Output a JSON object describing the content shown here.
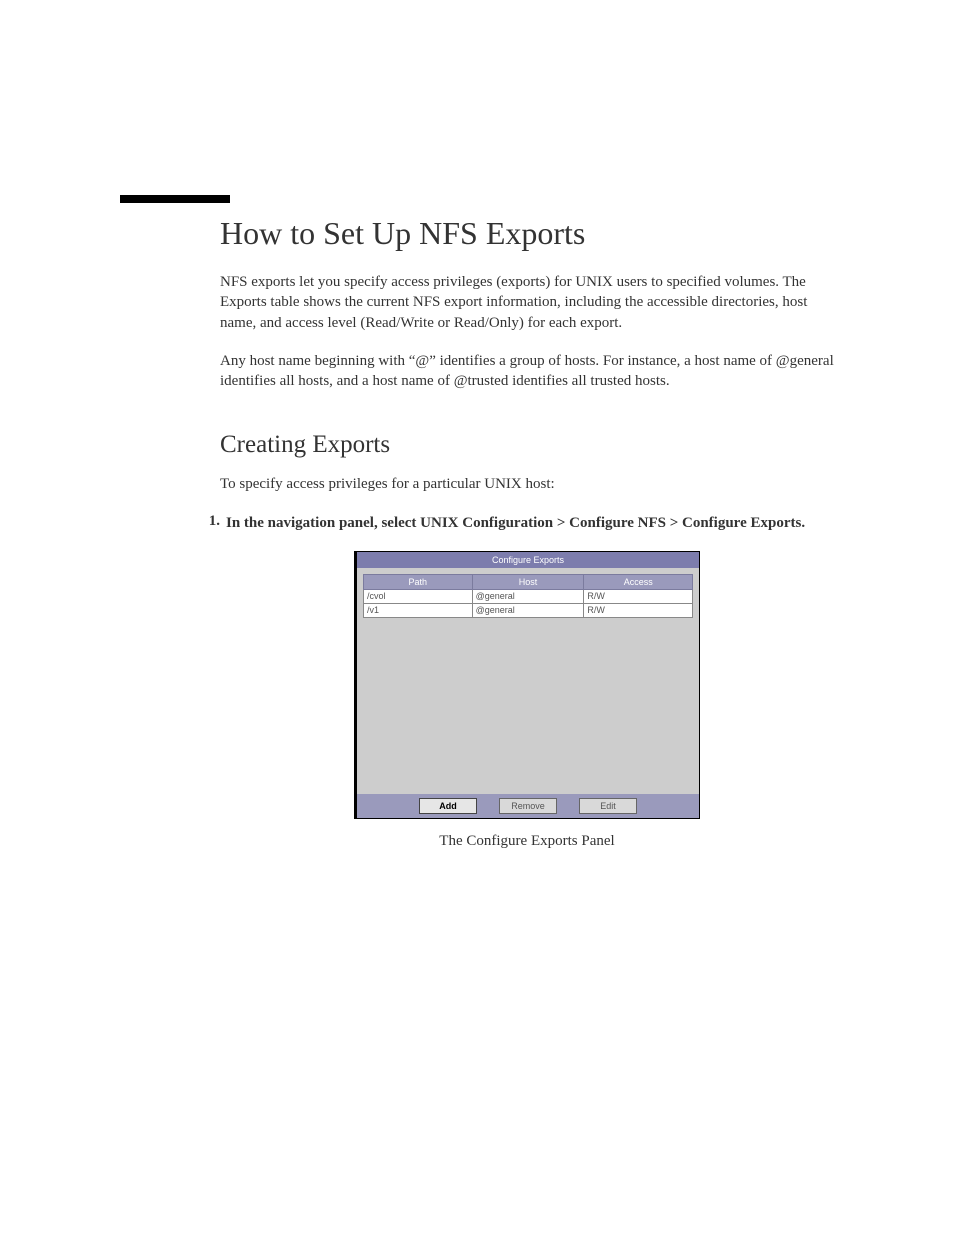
{
  "heading1": "How to Set Up NFS Exports",
  "para1": "NFS exports let you specify access privileges (exports) for UNIX users to specified volumes. The Exports table shows the current NFS export information, including the accessible directories, host name, and access level (Read/Write or Read/Only) for each export.",
  "para2": "Any host name beginning with “@” identifies a group of hosts. For instance, a host name of @general identifies all hosts, and a host name of @trusted identifies all trusted hosts.",
  "heading2": "Creating Exports",
  "para3": "To specify access privileges for a particular UNIX host:",
  "step1_num": "1.",
  "step1_text": "In the navigation panel, select UNIX Configuration > Configure NFS > Configure Exports.",
  "panel": {
    "title": "Configure Exports",
    "columns": {
      "path": "Path",
      "host": "Host",
      "access": "Access"
    },
    "rows": [
      {
        "path": "/cvol",
        "host": "@general",
        "access": "R/W"
      },
      {
        "path": "/v1",
        "host": "@general",
        "access": "R/W"
      }
    ],
    "buttons": {
      "add": "Add",
      "remove": "Remove",
      "edit": "Edit"
    }
  },
  "figure_caption": "The Configure Exports Panel"
}
